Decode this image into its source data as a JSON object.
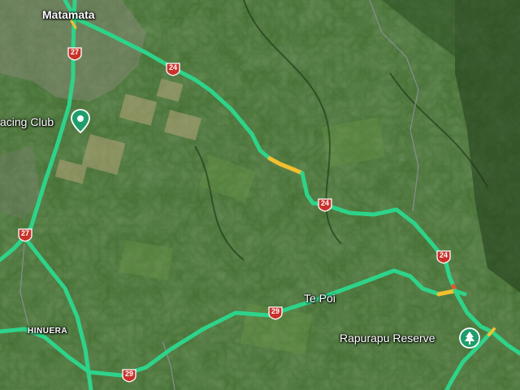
{
  "map": {
    "colors": {
      "road": "#2ed38a",
      "road_slow": "#f2c02f",
      "road_jam": "#e4572e",
      "shield": "#c8322b",
      "land": "#3f6b2e",
      "boundary": "#8f8f9a"
    },
    "places": [
      {
        "name": "Matamata",
        "type": "town"
      },
      {
        "name": "acing Club",
        "type": "poi",
        "icon": "map-pin-icon"
      },
      {
        "name": "Te Poi",
        "type": "locality"
      },
      {
        "name": "HINUERA",
        "type": "locality"
      },
      {
        "name": "Rapurapu Reserve",
        "type": "park",
        "icon": "tree-icon"
      }
    ],
    "route_shields": [
      "27",
      "24",
      "27",
      "24",
      "24",
      "29",
      "29"
    ]
  }
}
